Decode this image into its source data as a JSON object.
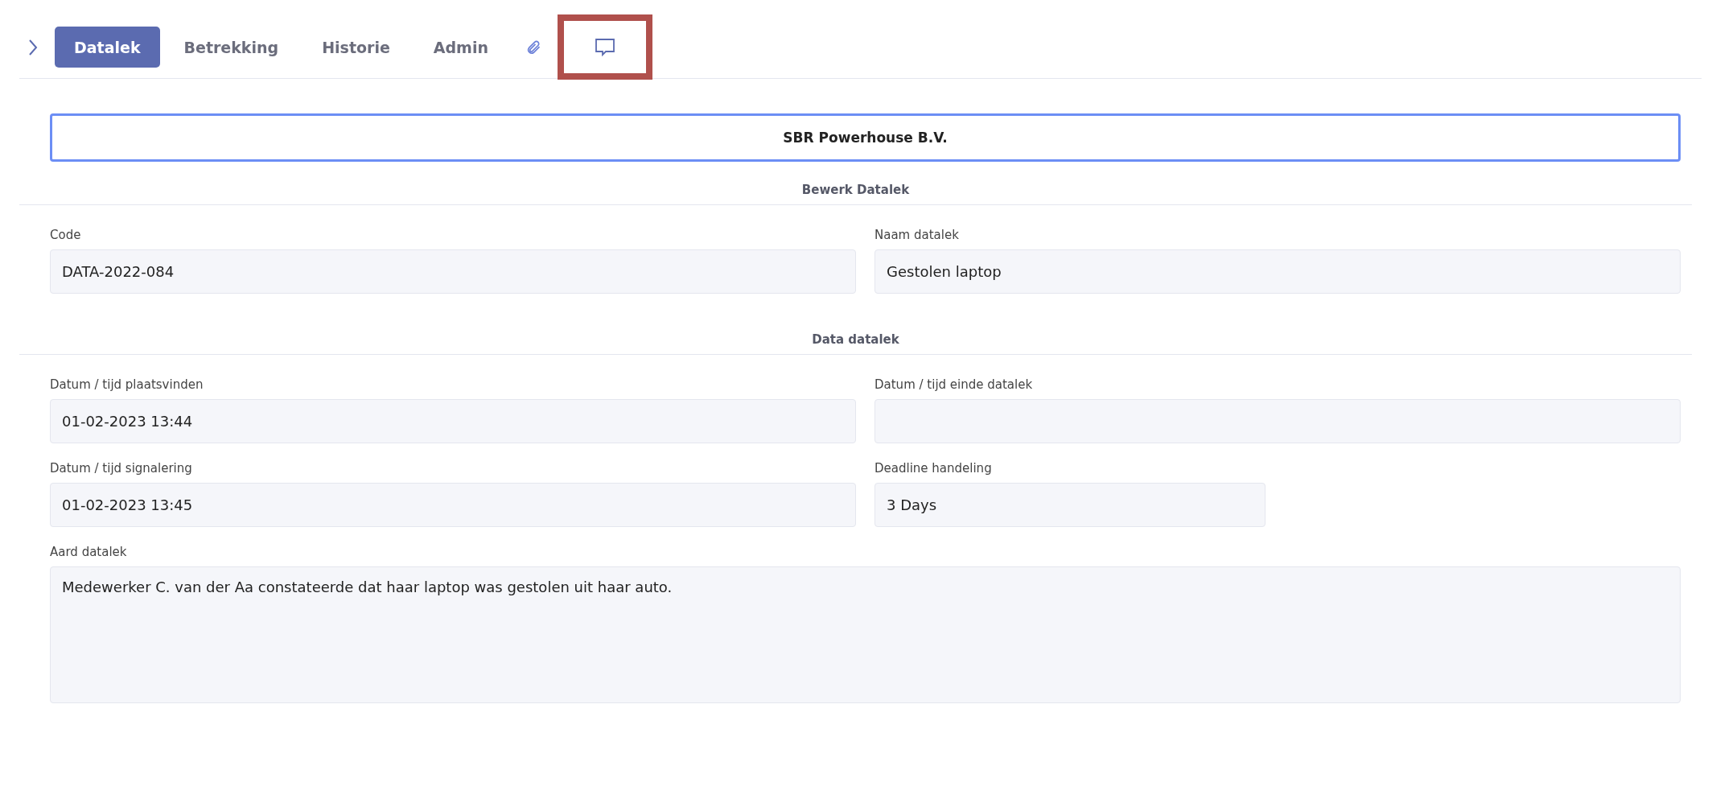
{
  "tabs": [
    {
      "kind": "text",
      "label": "Datalek",
      "selected": true
    },
    {
      "kind": "text",
      "label": "Betrekking",
      "selected": false
    },
    {
      "kind": "text",
      "label": "Historie",
      "selected": false
    },
    {
      "kind": "text",
      "label": "Admin",
      "selected": false
    },
    {
      "kind": "attachment",
      "selected": false,
      "highlighted": false
    },
    {
      "kind": "comment",
      "selected": false,
      "highlighted": true
    }
  ],
  "company": "SBR Powerhouse B.V.",
  "sections": [
    {
      "title": "Bewerk Datalek",
      "fields": [
        {
          "kind": "input",
          "label": "Code",
          "value": "DATA-2022-084"
        },
        {
          "kind": "input",
          "label": "Naam datalek",
          "value": "Gestolen laptop"
        }
      ]
    },
    {
      "title": "Data datalek",
      "fields": [
        {
          "kind": "input",
          "label": "Datum / tijd plaatsvinden",
          "value": "01-02-2023 13:44"
        },
        {
          "kind": "input",
          "label": "Datum / tijd einde datalek"
        },
        {
          "kind": "input",
          "label": "Datum / tijd signalering",
          "value": "01-02-2023 13:45"
        },
        {
          "kind": "short",
          "label": "Deadline handeling",
          "value": "3 Days"
        },
        {
          "kind": "textarea",
          "label": "Aard datalek",
          "value": "Medewerker C. van der Aa constateerde dat haar laptop was gestolen uit haar auto."
        }
      ]
    }
  ]
}
